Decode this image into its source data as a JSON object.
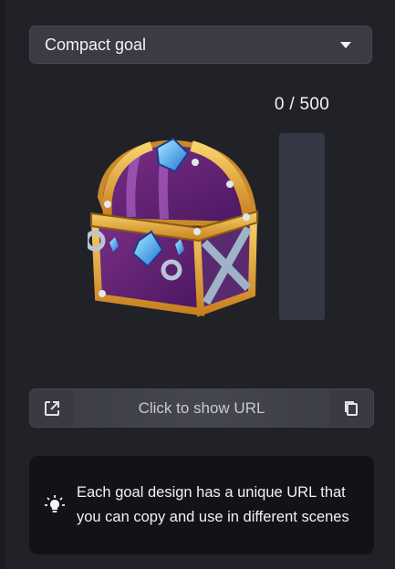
{
  "goal_select": {
    "value": "Compact goal",
    "icon": "chevron-down-icon"
  },
  "progress": {
    "label": "0 / 500",
    "current": 0,
    "target": 500,
    "fraction": 0,
    "fill_color": "#5b8ef2",
    "track_color": "#343845"
  },
  "preview": {
    "icon": "treasure-chest-icon"
  },
  "url_bar": {
    "open_icon": "external-link-icon",
    "label": "Click to show URL",
    "copy_icon": "copy-icon"
  },
  "info": {
    "icon": "lightbulb-icon",
    "text": "Each goal design has a unique URL that you can copy and use in different scenes"
  }
}
